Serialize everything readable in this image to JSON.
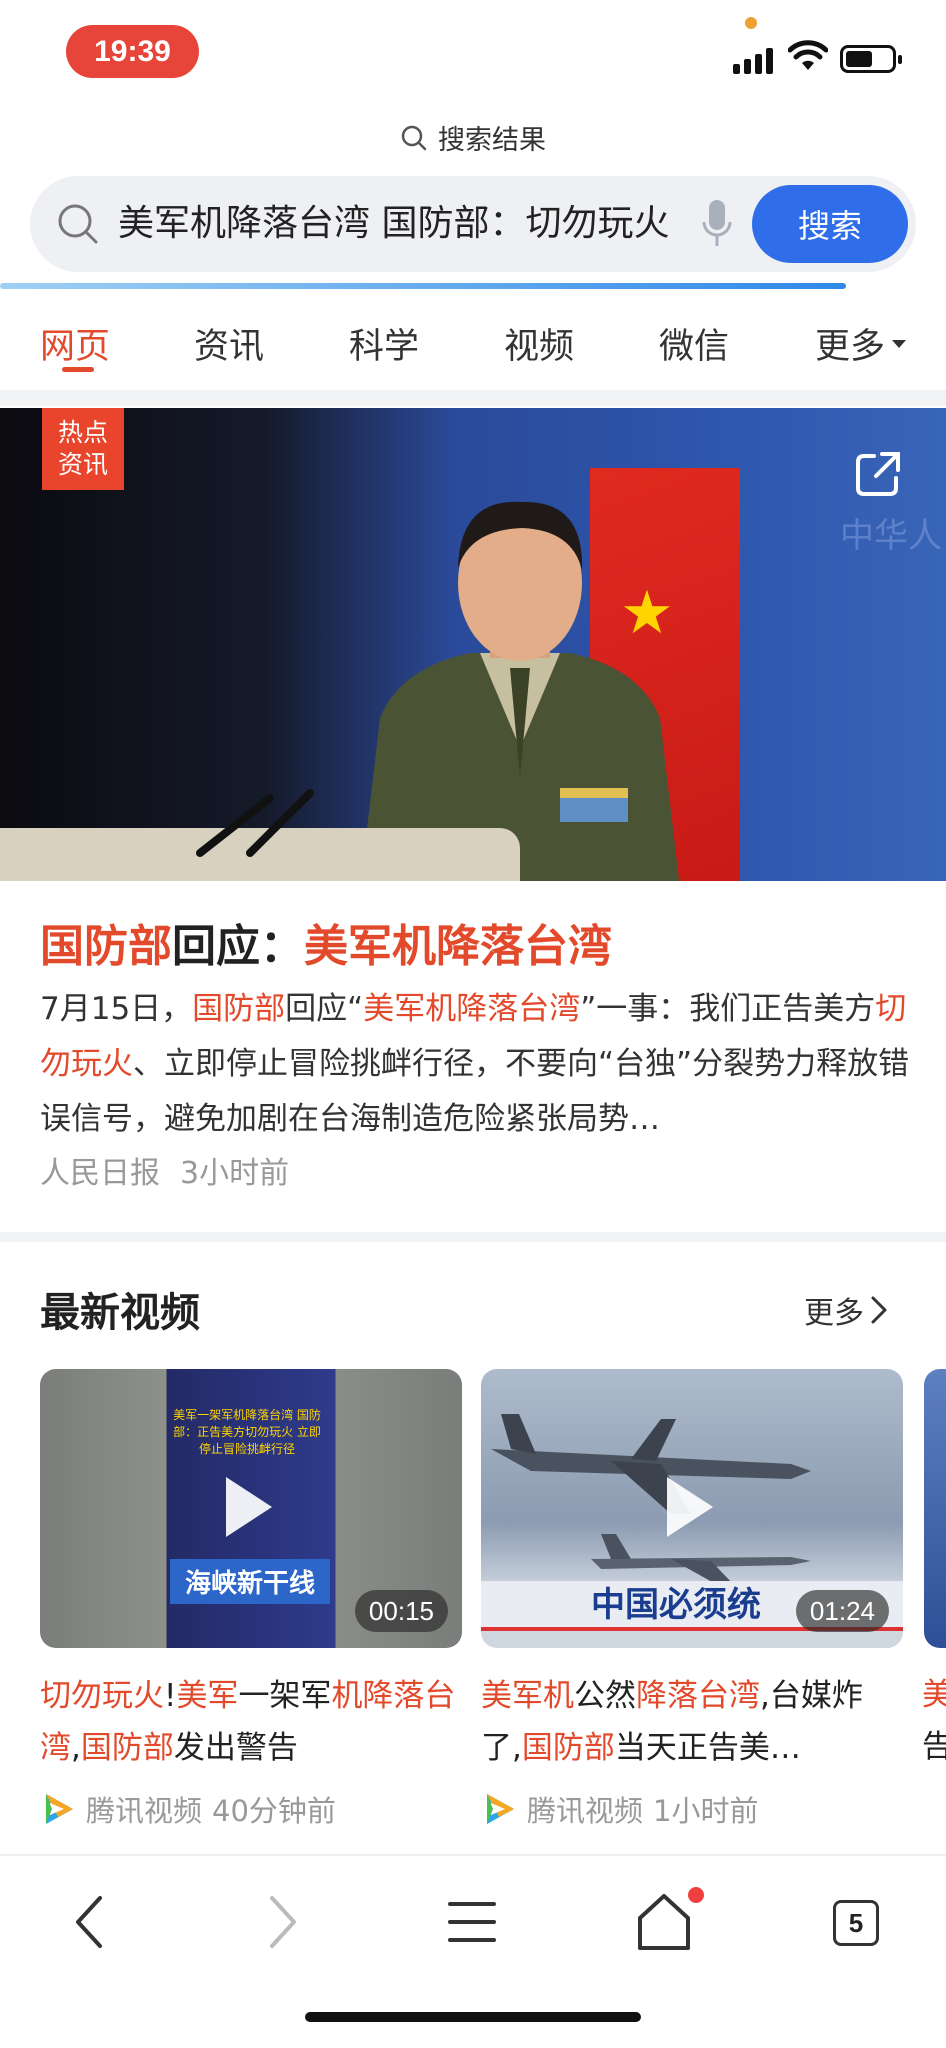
{
  "status_bar": {
    "time": "19:39"
  },
  "header": {
    "result_label": "搜索结果",
    "query": "美军机降落台湾 国防部：切勿玩火",
    "search_button": "搜索"
  },
  "tabs": [
    {
      "label": "网页",
      "active": true
    },
    {
      "label": "资讯"
    },
    {
      "label": "科学"
    },
    {
      "label": "视频"
    },
    {
      "label": "微信"
    },
    {
      "label": "更多"
    }
  ],
  "hero": {
    "badge_line1": "热点",
    "badge_line2": "资讯"
  },
  "article": {
    "title_part1": "国防部",
    "title_part2": "回应：",
    "title_part3": "美军机降落台湾",
    "body": {
      "p1": "7月15日，",
      "p2": "国防部",
      "p3": "回应“",
      "p4": "美军机降落台湾",
      "p5": "”一事：我们正告美方",
      "p6": "切勿玩火",
      "p7": "、立即停止冒险挑衅行径，不要向“台独”分裂势力释放错误信号，避免加剧在台海制造危险紧张局势…"
    },
    "source": "人民日报",
    "time": "3小时前"
  },
  "videos_section": {
    "title": "最新视频",
    "more": "更多",
    "items": [
      {
        "duration": "00:15",
        "thumb_caption": "美军一架军机降落台湾 国防部：正告美方切勿玩火 立即停止冒险挑衅行径",
        "thumb_logo": "海峡新干线",
        "title_parts": [
          "切勿玩火",
          "!",
          "美军",
          "一架军",
          "机降落台湾",
          ",",
          "国防部",
          "发出警告"
        ],
        "source": "腾讯视频",
        "time": "40分钟前"
      },
      {
        "duration": "01:24",
        "thumb_band": "中国必须统",
        "title_parts": [
          "美军机",
          "公然",
          "降落台湾",
          ",台媒炸了,",
          "国防部",
          "当天正告美…"
        ],
        "source": "腾讯视频",
        "time": "1小时前"
      }
    ],
    "peek_text_line1": "美",
    "peek_text_line2": "告"
  },
  "bottom_nav": {
    "tab_count": "5"
  },
  "colors": {
    "accent": "#e24a2b",
    "primary_blue": "#2f6ee8",
    "time_pill": "#e8453a"
  }
}
